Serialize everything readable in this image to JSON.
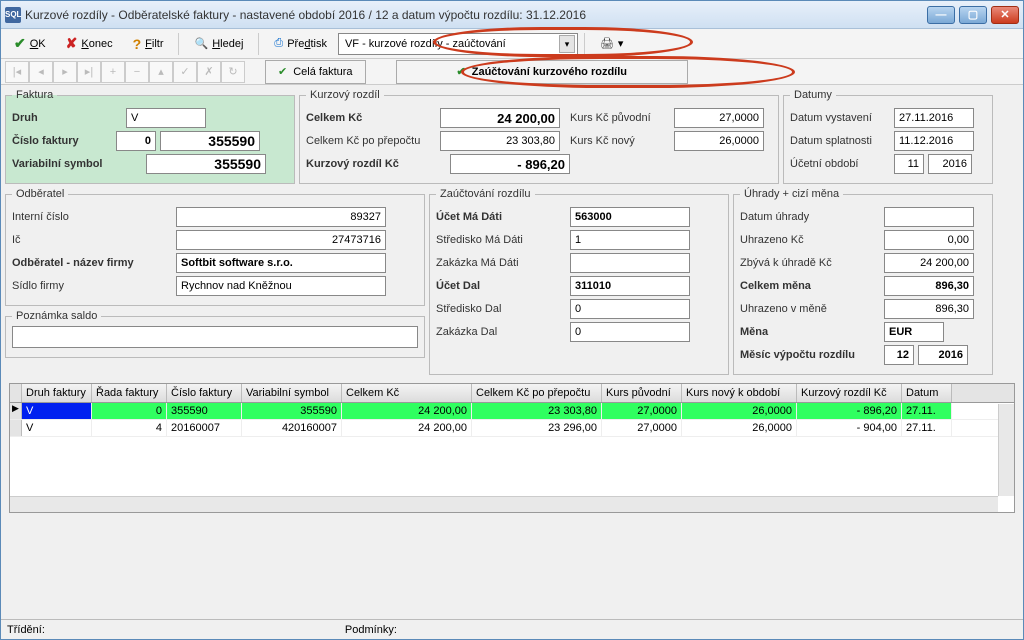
{
  "title": "Kurzové rozdíly - Odběratelské faktury - nastavené období 2016 / 12 a datum výpočtu rozdílu: 31.12.2016",
  "toolbar": {
    "ok": "OK",
    "konec": "Konec",
    "filtr": "Filtr",
    "hledej": "Hledej",
    "predtisk": "Předtisk",
    "combo": "VF - kurzové rozdíly - zaúčtování"
  },
  "nav": {
    "cela": "Celá faktura",
    "zauct": "Zaúčtování kurzového rozdílu"
  },
  "faktura": {
    "legend": "Faktura",
    "druh_l": "Druh",
    "druh": "V",
    "cislo_l": "Číslo faktury",
    "cislo_a": "0",
    "cislo_b": "355590",
    "vs_l": "Variabilní symbol",
    "vs": "355590"
  },
  "kurz": {
    "legend": "Kurzový rozdíl",
    "celkem_l": "Celkem Kč",
    "celkem": "24 200,00",
    "po_l": "Celkem Kč po přepočtu",
    "po": "23 303,80",
    "rozdil_l": "Kurzový rozdíl Kč",
    "rozdil": "-   896,20",
    "puv_l": "Kurs Kč původní",
    "puv": "27,0000",
    "novy_l": "Kurs Kč nový",
    "novy": "26,0000"
  },
  "datumy": {
    "legend": "Datumy",
    "vyst_l": "Datum vystavení",
    "vyst": "27.11.2016",
    "spl_l": "Datum splatnosti",
    "spl": "11.12.2016",
    "obd_l": "Účetní období",
    "obd_m": "11",
    "obd_r": "2016"
  },
  "odb": {
    "legend": "Odběratel",
    "int_l": "Interní číslo",
    "int": "89327",
    "ic_l": "Ič",
    "ic": "27473716",
    "nazev_l": "Odběratel - název firmy",
    "nazev": "Softbit software s.r.o.",
    "sidlo_l": "Sídlo firmy",
    "sidlo": "Rychnov nad Kněžnou"
  },
  "pozn": {
    "legend": "Poznámka saldo",
    "val": ""
  },
  "zauct": {
    "legend": "Zaúčtování rozdílu",
    "md_l": "Účet Má Dáti",
    "md": "563000",
    "smd_l": "Středisko Má Dáti",
    "smd": "1",
    "zmd_l": "Zakázka  Má Dáti",
    "zmd": "",
    "d_l": "Účet Dal",
    "d": "311010",
    "sd_l": "Středisko Dal",
    "sd": "0",
    "zd_l": "Zakázka Dal",
    "zd": "0"
  },
  "uhr": {
    "legend": "Úhrady + cizí měna",
    "du_l": "Datum úhrady",
    "du": "",
    "uk_l": "Uhrazeno Kč",
    "uk": "0,00",
    "zb_l": "Zbývá k úhradě Kč",
    "zb": "24 200,00",
    "cm_l": "Celkem měna",
    "cm": "896,30",
    "um_l": "Uhrazeno v měně",
    "um": "896,30",
    "mena_l": "Měna",
    "mena": "EUR",
    "mes_l": "Měsíc výpočtu rozdílu",
    "mes_m": "12",
    "mes_r": "2016"
  },
  "grid": {
    "cols": [
      "Druh faktury",
      "Řada faktury",
      "Číslo faktury",
      "Variabilní symbol",
      "Celkem Kč",
      "Celkem Kč po přepočtu",
      "Kurs původní",
      "Kurs nový k období",
      "Kurzový rozdíl Kč",
      "Datum"
    ],
    "r1": {
      "druh": "V",
      "rada": "0",
      "cislo": "355590",
      "vs": "355590",
      "celkem": "24 200,00",
      "po": "23 303,80",
      "kp": "27,0000",
      "kn": "26,0000",
      "kr": "- 896,20",
      "dat": "27.11."
    },
    "r2": {
      "druh": "V",
      "rada": "4",
      "cislo": "20160007",
      "vs": "420160007",
      "celkem": "24 200,00",
      "po": "23 296,00",
      "kp": "27,0000",
      "kn": "26,0000",
      "kr": "- 904,00",
      "dat": "27.11."
    }
  },
  "status": {
    "trideni": "Třídění:",
    "podminky": "Podmínky:"
  }
}
